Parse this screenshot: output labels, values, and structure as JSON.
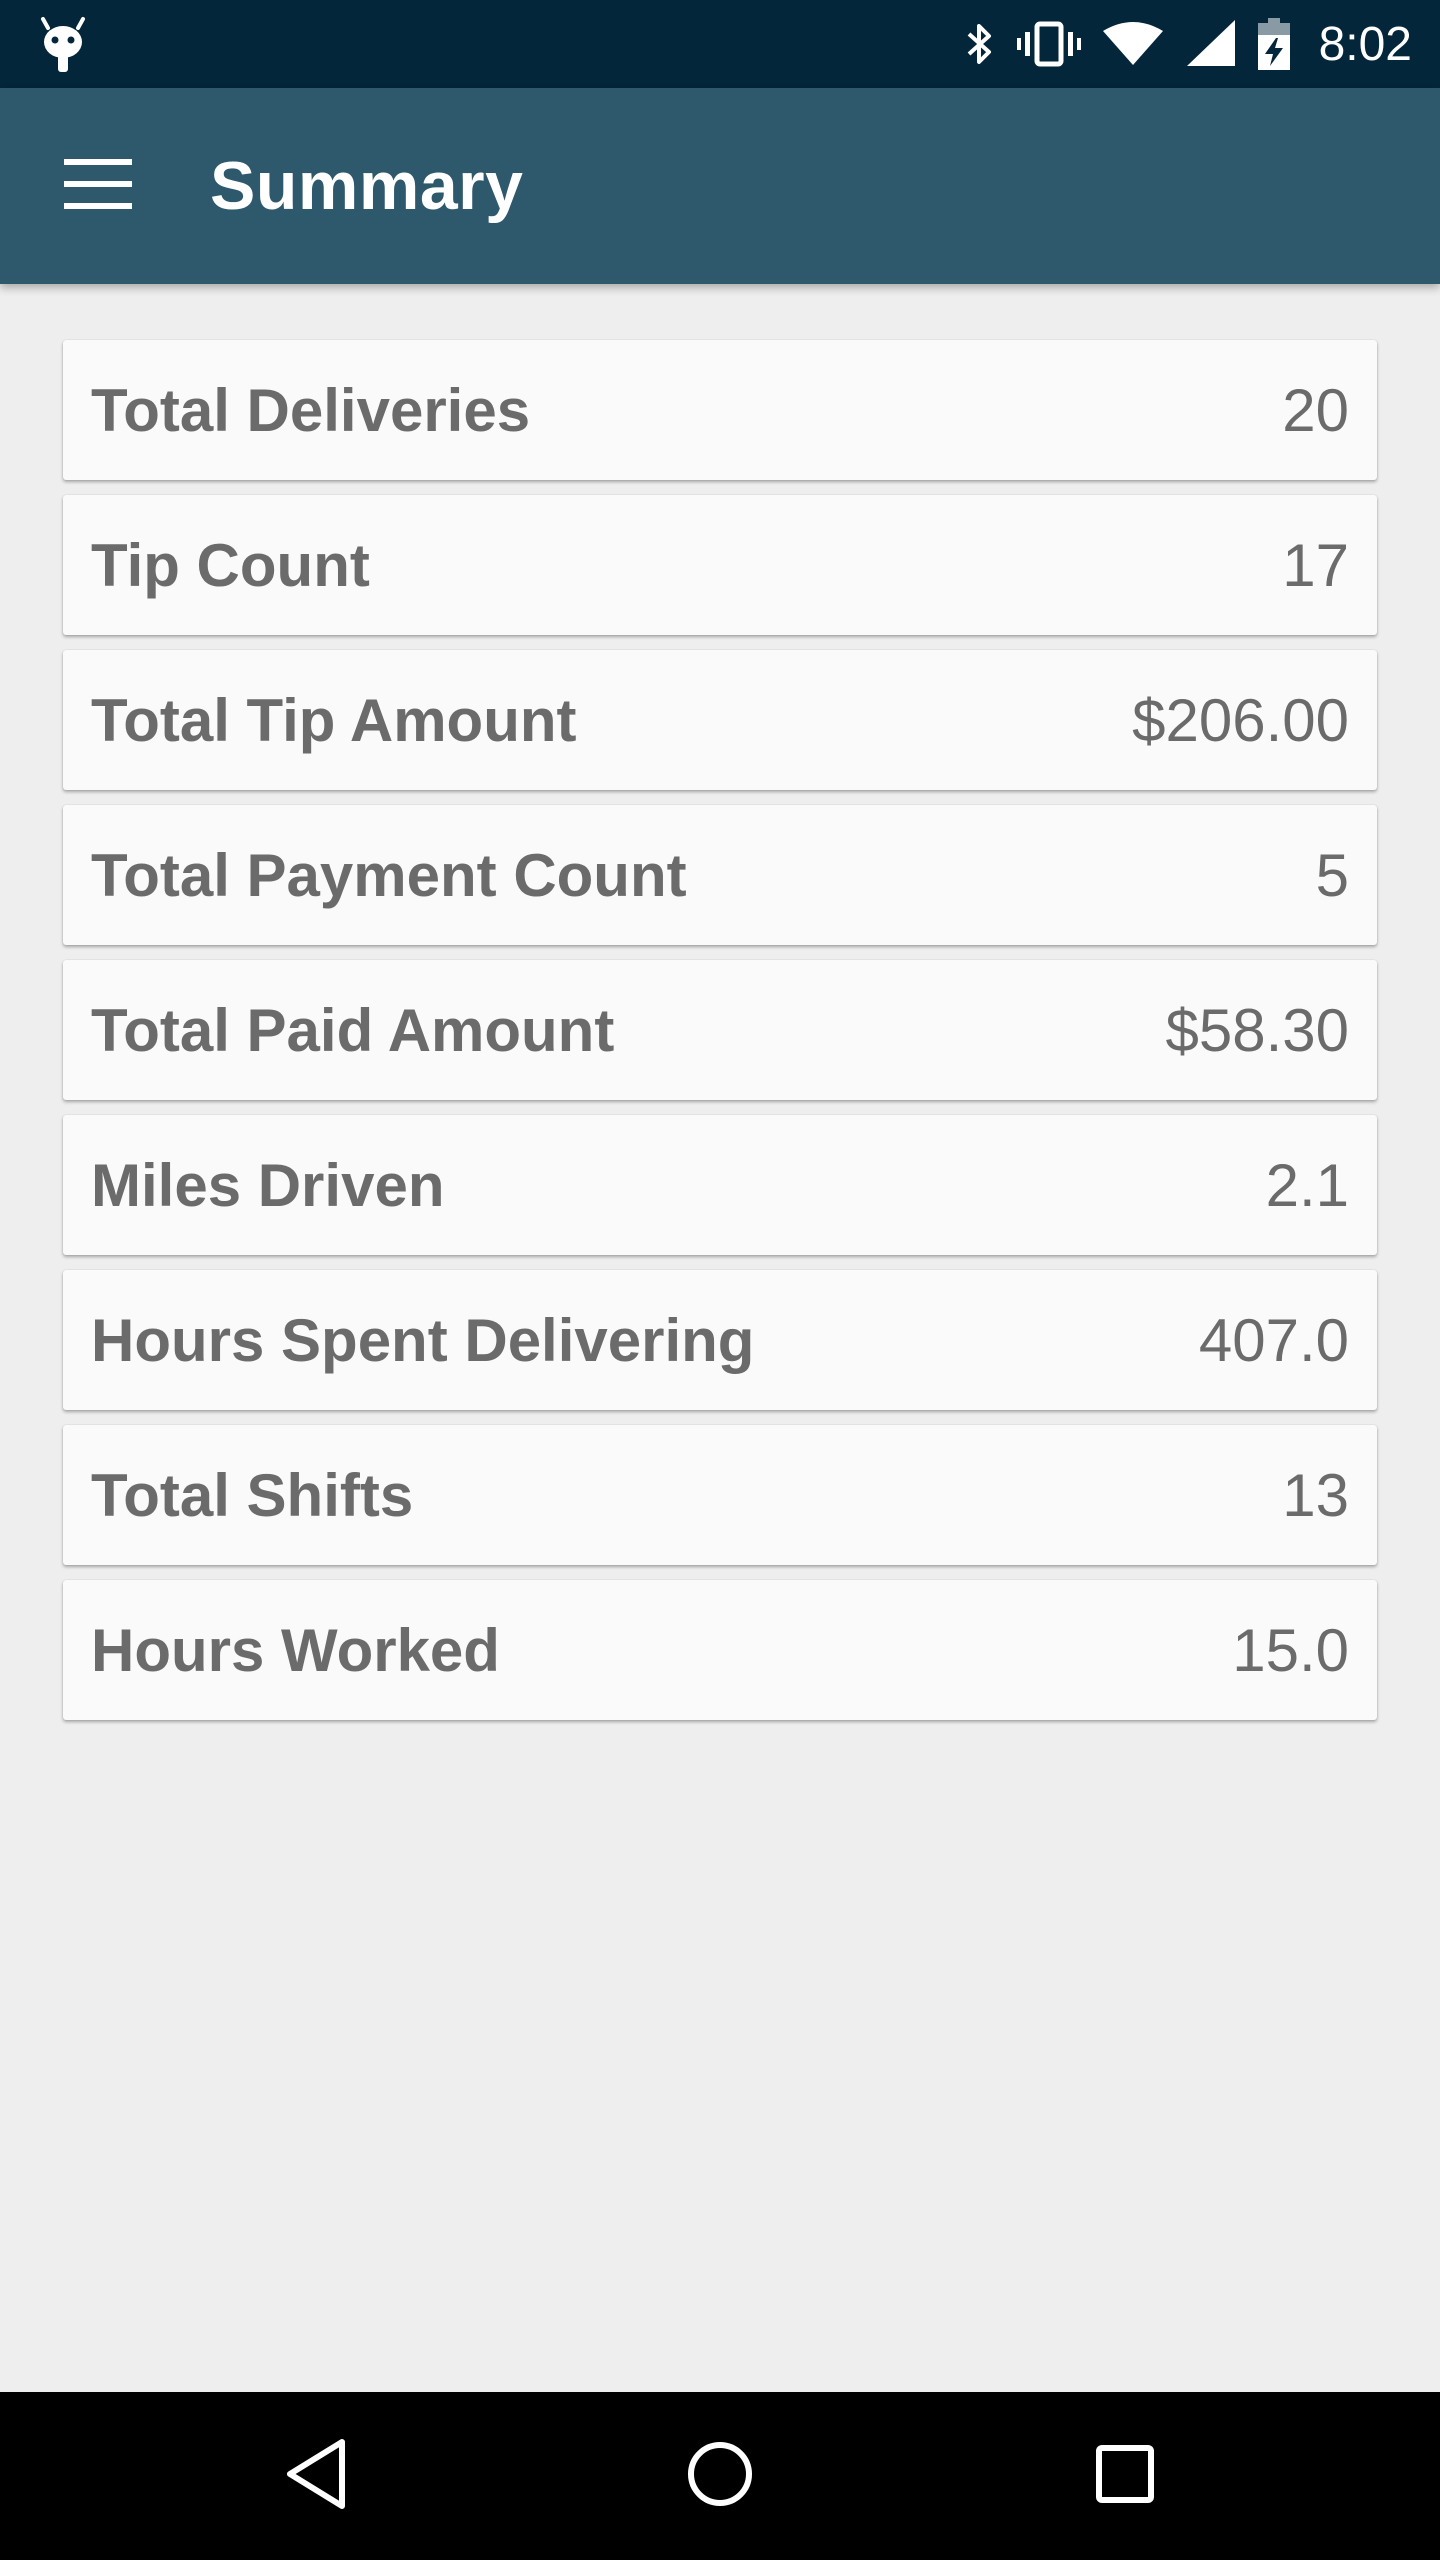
{
  "status_bar": {
    "time": "8:02",
    "icons": [
      "android-debug-icon",
      "bluetooth-icon",
      "vibrate-icon",
      "wifi-icon",
      "cell-signal-icon",
      "battery-charging-icon"
    ]
  },
  "app_bar": {
    "title": "Summary",
    "menu_icon": "hamburger-menu-icon"
  },
  "summary": {
    "rows": [
      {
        "label": "Total Deliveries",
        "value": "20"
      },
      {
        "label": "Tip Count",
        "value": "17"
      },
      {
        "label": "Total Tip Amount",
        "value": "$206.00"
      },
      {
        "label": "Total Payment Count",
        "value": "5"
      },
      {
        "label": "Total Paid Amount",
        "value": "$58.30"
      },
      {
        "label": "Miles Driven",
        "value": "2.1"
      },
      {
        "label": "Hours Spent Delivering",
        "value": "407.0"
      },
      {
        "label": "Total Shifts",
        "value": "13"
      },
      {
        "label": "Hours Worked",
        "value": "15.0"
      }
    ]
  },
  "nav_bar": {
    "icons": [
      "back-icon",
      "home-icon",
      "recents-icon"
    ]
  },
  "colors": {
    "status_bar": "#03263a",
    "app_bar": "#2e586b",
    "background": "#eeeeee",
    "card": "#fafafa",
    "text": "#6b6b6b",
    "nav_bar": "#000000"
  }
}
